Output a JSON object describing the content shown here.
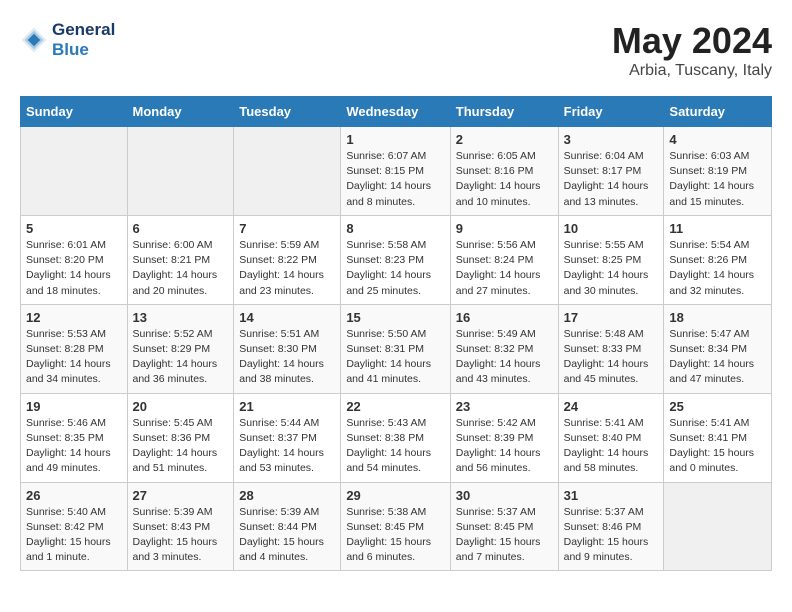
{
  "header": {
    "logo_line1": "General",
    "logo_line2": "Blue",
    "month": "May 2024",
    "location": "Arbia, Tuscany, Italy"
  },
  "weekdays": [
    "Sunday",
    "Monday",
    "Tuesday",
    "Wednesday",
    "Thursday",
    "Friday",
    "Saturday"
  ],
  "weeks": [
    [
      {
        "day": "",
        "info": ""
      },
      {
        "day": "",
        "info": ""
      },
      {
        "day": "",
        "info": ""
      },
      {
        "day": "1",
        "info": "Sunrise: 6:07 AM\nSunset: 8:15 PM\nDaylight: 14 hours\nand 8 minutes."
      },
      {
        "day": "2",
        "info": "Sunrise: 6:05 AM\nSunset: 8:16 PM\nDaylight: 14 hours\nand 10 minutes."
      },
      {
        "day": "3",
        "info": "Sunrise: 6:04 AM\nSunset: 8:17 PM\nDaylight: 14 hours\nand 13 minutes."
      },
      {
        "day": "4",
        "info": "Sunrise: 6:03 AM\nSunset: 8:19 PM\nDaylight: 14 hours\nand 15 minutes."
      }
    ],
    [
      {
        "day": "5",
        "info": "Sunrise: 6:01 AM\nSunset: 8:20 PM\nDaylight: 14 hours\nand 18 minutes."
      },
      {
        "day": "6",
        "info": "Sunrise: 6:00 AM\nSunset: 8:21 PM\nDaylight: 14 hours\nand 20 minutes."
      },
      {
        "day": "7",
        "info": "Sunrise: 5:59 AM\nSunset: 8:22 PM\nDaylight: 14 hours\nand 23 minutes."
      },
      {
        "day": "8",
        "info": "Sunrise: 5:58 AM\nSunset: 8:23 PM\nDaylight: 14 hours\nand 25 minutes."
      },
      {
        "day": "9",
        "info": "Sunrise: 5:56 AM\nSunset: 8:24 PM\nDaylight: 14 hours\nand 27 minutes."
      },
      {
        "day": "10",
        "info": "Sunrise: 5:55 AM\nSunset: 8:25 PM\nDaylight: 14 hours\nand 30 minutes."
      },
      {
        "day": "11",
        "info": "Sunrise: 5:54 AM\nSunset: 8:26 PM\nDaylight: 14 hours\nand 32 minutes."
      }
    ],
    [
      {
        "day": "12",
        "info": "Sunrise: 5:53 AM\nSunset: 8:28 PM\nDaylight: 14 hours\nand 34 minutes."
      },
      {
        "day": "13",
        "info": "Sunrise: 5:52 AM\nSunset: 8:29 PM\nDaylight: 14 hours\nand 36 minutes."
      },
      {
        "day": "14",
        "info": "Sunrise: 5:51 AM\nSunset: 8:30 PM\nDaylight: 14 hours\nand 38 minutes."
      },
      {
        "day": "15",
        "info": "Sunrise: 5:50 AM\nSunset: 8:31 PM\nDaylight: 14 hours\nand 41 minutes."
      },
      {
        "day": "16",
        "info": "Sunrise: 5:49 AM\nSunset: 8:32 PM\nDaylight: 14 hours\nand 43 minutes."
      },
      {
        "day": "17",
        "info": "Sunrise: 5:48 AM\nSunset: 8:33 PM\nDaylight: 14 hours\nand 45 minutes."
      },
      {
        "day": "18",
        "info": "Sunrise: 5:47 AM\nSunset: 8:34 PM\nDaylight: 14 hours\nand 47 minutes."
      }
    ],
    [
      {
        "day": "19",
        "info": "Sunrise: 5:46 AM\nSunset: 8:35 PM\nDaylight: 14 hours\nand 49 minutes."
      },
      {
        "day": "20",
        "info": "Sunrise: 5:45 AM\nSunset: 8:36 PM\nDaylight: 14 hours\nand 51 minutes."
      },
      {
        "day": "21",
        "info": "Sunrise: 5:44 AM\nSunset: 8:37 PM\nDaylight: 14 hours\nand 53 minutes."
      },
      {
        "day": "22",
        "info": "Sunrise: 5:43 AM\nSunset: 8:38 PM\nDaylight: 14 hours\nand 54 minutes."
      },
      {
        "day": "23",
        "info": "Sunrise: 5:42 AM\nSunset: 8:39 PM\nDaylight: 14 hours\nand 56 minutes."
      },
      {
        "day": "24",
        "info": "Sunrise: 5:41 AM\nSunset: 8:40 PM\nDaylight: 14 hours\nand 58 minutes."
      },
      {
        "day": "25",
        "info": "Sunrise: 5:41 AM\nSunset: 8:41 PM\nDaylight: 15 hours\nand 0 minutes."
      }
    ],
    [
      {
        "day": "26",
        "info": "Sunrise: 5:40 AM\nSunset: 8:42 PM\nDaylight: 15 hours\nand 1 minute."
      },
      {
        "day": "27",
        "info": "Sunrise: 5:39 AM\nSunset: 8:43 PM\nDaylight: 15 hours\nand 3 minutes."
      },
      {
        "day": "28",
        "info": "Sunrise: 5:39 AM\nSunset: 8:44 PM\nDaylight: 15 hours\nand 4 minutes."
      },
      {
        "day": "29",
        "info": "Sunrise: 5:38 AM\nSunset: 8:45 PM\nDaylight: 15 hours\nand 6 minutes."
      },
      {
        "day": "30",
        "info": "Sunrise: 5:37 AM\nSunset: 8:45 PM\nDaylight: 15 hours\nand 7 minutes."
      },
      {
        "day": "31",
        "info": "Sunrise: 5:37 AM\nSunset: 8:46 PM\nDaylight: 15 hours\nand 9 minutes."
      },
      {
        "day": "",
        "info": ""
      }
    ]
  ]
}
